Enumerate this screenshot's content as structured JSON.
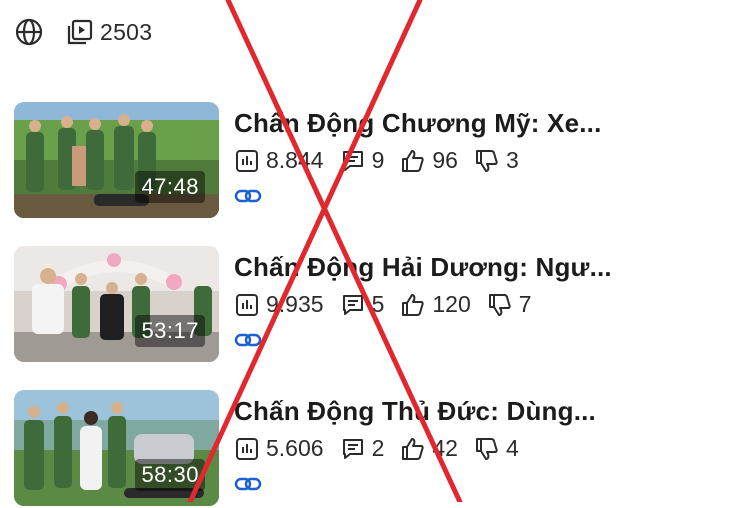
{
  "header": {
    "video_count": "2503",
    "globe_icon": "globe-icon",
    "video_library_icon": "video-library-icon"
  },
  "videos": [
    {
      "title": "Chấn Động Chương Mỹ: Xe...",
      "duration": "47:48",
      "views": "8.844",
      "comments": "9",
      "likes": "96",
      "dislikes": "3"
    },
    {
      "title": "Chấn Động Hải Dương: Ngư...",
      "duration": "53:17",
      "views": "9.935",
      "comments": "5",
      "likes": "120",
      "dislikes": "7"
    },
    {
      "title": "Chấn Động Thủ Đức: Dùng...",
      "duration": "58:30",
      "views": "5.606",
      "comments": "2",
      "likes": "42",
      "dislikes": "4"
    }
  ],
  "colors": {
    "accent_link": "#1a5fd0",
    "overlay_x": "#e0282e"
  }
}
